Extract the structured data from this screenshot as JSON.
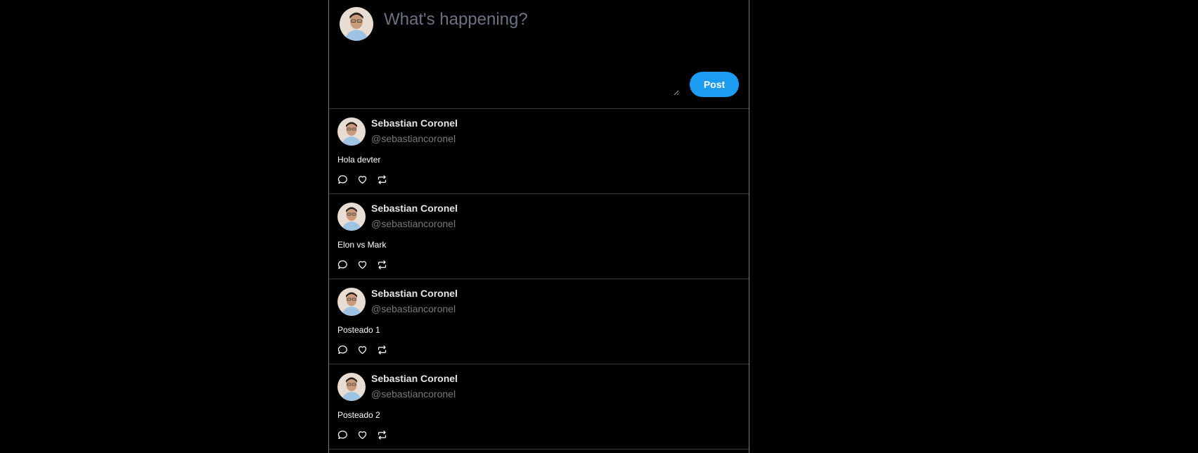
{
  "composer": {
    "placeholder": "What's happening?",
    "post_label": "Post"
  },
  "posts": [
    {
      "name": "Sebastian Coronel",
      "handle": "@sebastiancoronel",
      "text": "Hola devter"
    },
    {
      "name": "Sebastian Coronel",
      "handle": "@sebastiancoronel",
      "text": "Elon vs Mark"
    },
    {
      "name": "Sebastian Coronel",
      "handle": "@sebastiancoronel",
      "text": "Posteado 1"
    },
    {
      "name": "Sebastian Coronel",
      "handle": "@sebastiancoronel",
      "text": "Posteado 2"
    }
  ],
  "icons": [
    "comment-icon",
    "heart-icon",
    "retweet-icon"
  ],
  "colors": {
    "accent": "#1d9bf0",
    "background": "#000000",
    "muted": "#7a7a7a",
    "placeholder": "#6b7280"
  }
}
